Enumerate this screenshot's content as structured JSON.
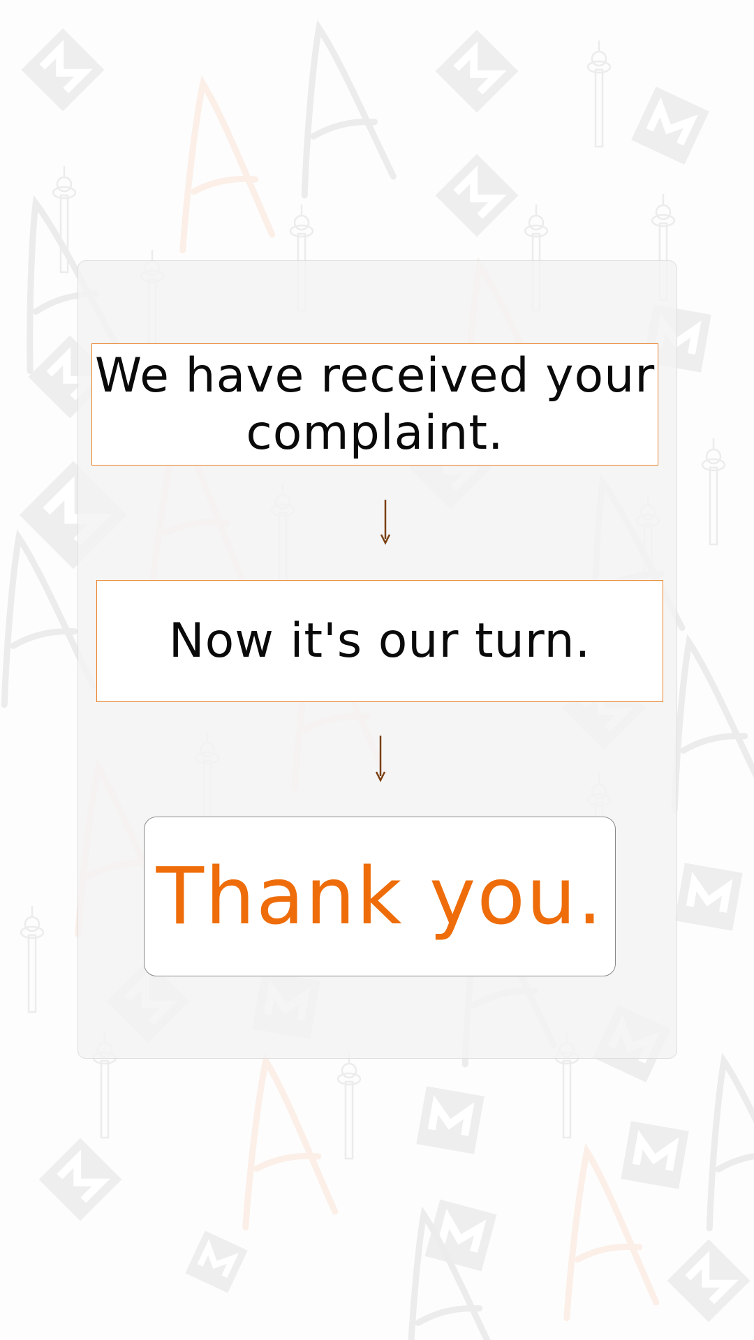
{
  "messages": {
    "received": "We have received your complaint.",
    "our_turn": "Now it's our turn.",
    "thank_you": "Thank you."
  },
  "colors": {
    "accent": "#ee6d0a",
    "box_border": "#e8822a",
    "arrow": "#7a3f12",
    "card_bg": "#f3f3f3",
    "page_bg": "#fdfdfd"
  },
  "icons": [
    "arrow-down-icon",
    "m-logo-icon",
    "tower-icon",
    "letter-a-icon"
  ]
}
